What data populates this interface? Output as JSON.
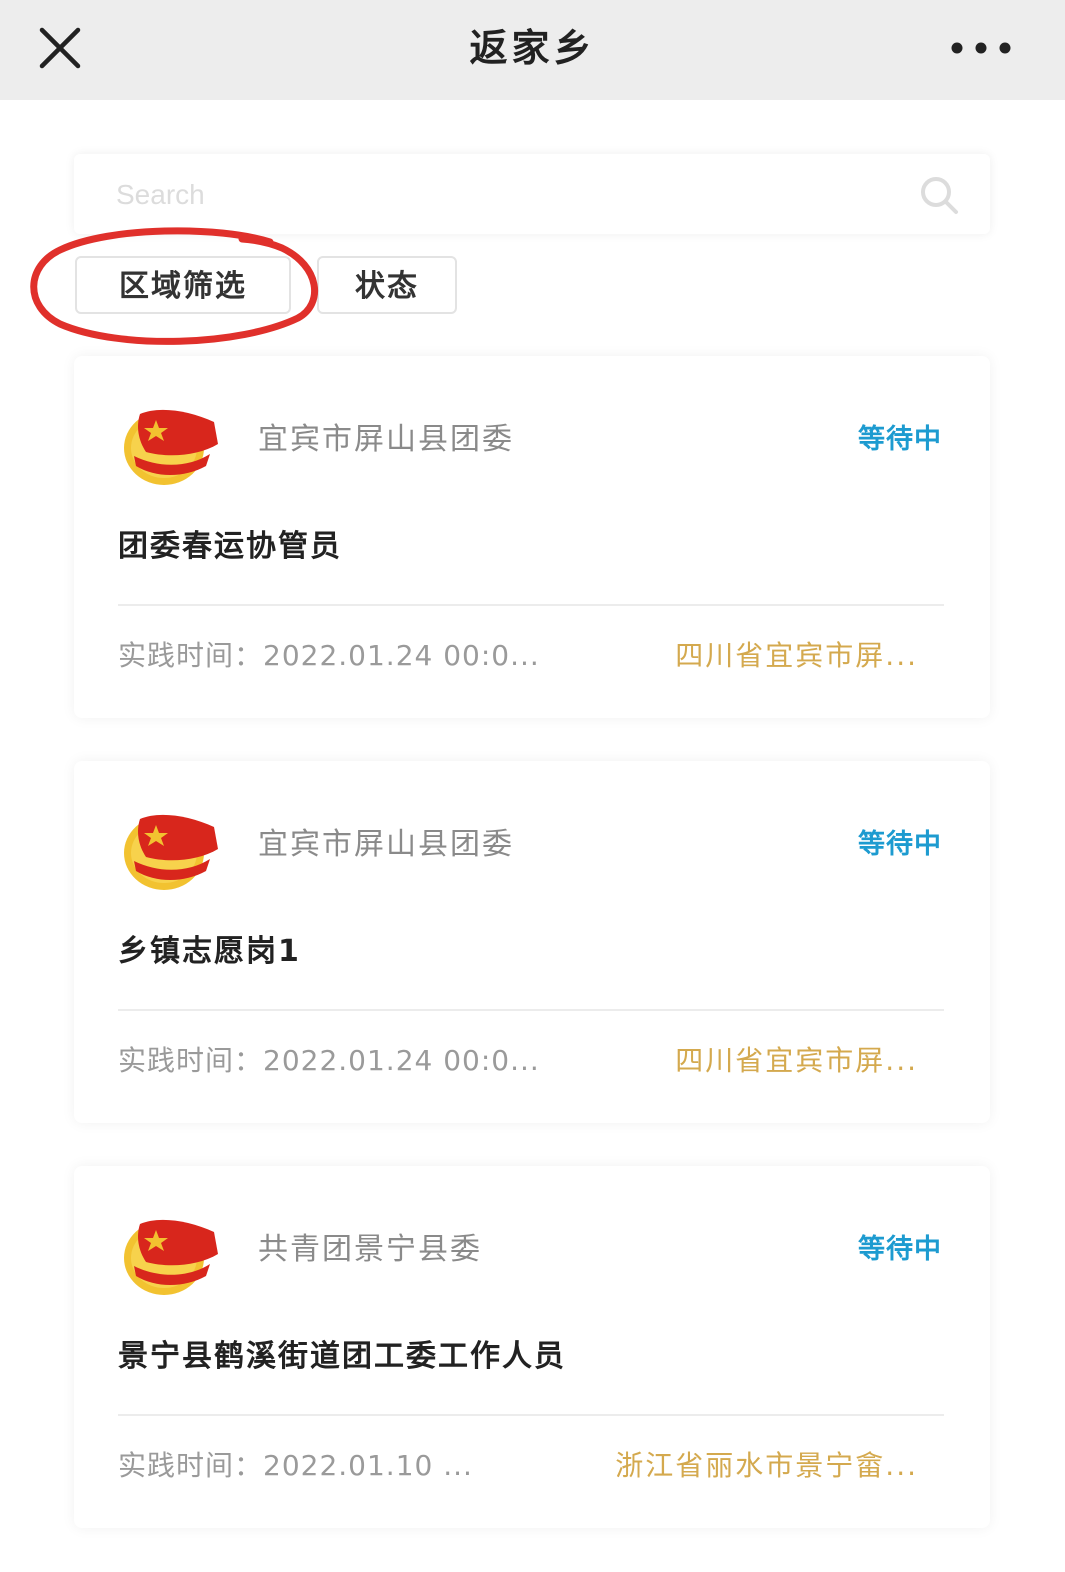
{
  "header": {
    "title": "返家乡",
    "close_icon": "close-icon",
    "more_icon": "more-dots-icon"
  },
  "search": {
    "placeholder": "Search",
    "value": "",
    "icon": "search-icon"
  },
  "filters": [
    {
      "label": "区域筛选"
    },
    {
      "label": "状态"
    }
  ],
  "annotation": {
    "shape": "red hand-drawn ellipse around the region filter button",
    "color": "#e0302b"
  },
  "cards": [
    {
      "logo": "youth-league-emblem-icon",
      "org": "宜宾市屏山县团委",
      "status": "等待中",
      "job": "团委春运协管员",
      "time": "实践时间：2022.01.24 00:0...",
      "location": "四川省宜宾市屏..."
    },
    {
      "logo": "youth-league-emblem-icon",
      "org": "宜宾市屏山县团委",
      "status": "等待中",
      "job": "乡镇志愿岗1",
      "time": "实践时间：2022.01.24 00:0...",
      "location": "四川省宜宾市屏..."
    },
    {
      "logo": "youth-league-emblem-icon",
      "org": "共青团景宁县委",
      "status": "等待中",
      "job": "景宁县鹤溪街道团工委工作人员",
      "time": "实践时间：2022.01.10 ...",
      "location": "浙江省丽水市景宁畲..."
    }
  ],
  "colors": {
    "topbar_bg": "#ededed",
    "status": "#1d9bd0",
    "location": "#d4a94e",
    "muted_text": "#9a9a9a",
    "annotation_red": "#e0302b",
    "emblem_red": "#d8261c",
    "emblem_gold": "#f2c230"
  }
}
